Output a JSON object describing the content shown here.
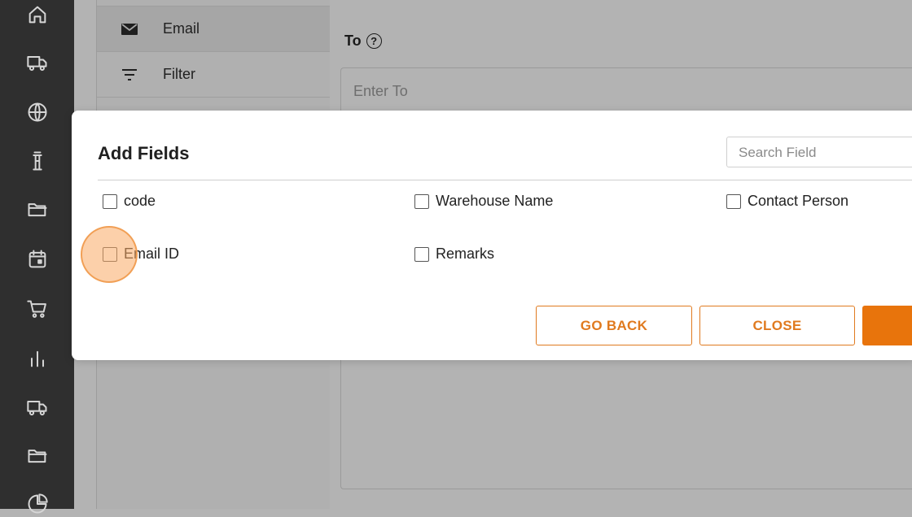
{
  "rail": {
    "icons": [
      "home-icon",
      "truck-icon",
      "globe-icon",
      "tower-icon",
      "folder-icon",
      "calendar-icon",
      "cart-icon",
      "bar-chart-icon",
      "truck-icon",
      "folder-icon",
      "pie-chart-icon"
    ]
  },
  "side_panel": {
    "items": [
      {
        "label": "Email",
        "icon": "mail-icon",
        "active": true
      },
      {
        "label": "Filter",
        "icon": "filter-icon",
        "active": false
      }
    ]
  },
  "main": {
    "to_label": "To",
    "help_glyph": "?",
    "to_placeholder": "Enter To"
  },
  "modal": {
    "title": "Add Fields",
    "search_placeholder": "Search Field",
    "fields": [
      {
        "label": "code",
        "checked": false
      },
      {
        "label": "Warehouse Name",
        "checked": false
      },
      {
        "label": "Contact Person",
        "checked": false
      },
      {
        "label": "Email ID",
        "checked": false
      },
      {
        "label": "Remarks",
        "checked": false
      }
    ],
    "buttons": {
      "go_back": "GO BACK",
      "close": "CLOSE"
    },
    "accent_color": "#e8740c"
  }
}
